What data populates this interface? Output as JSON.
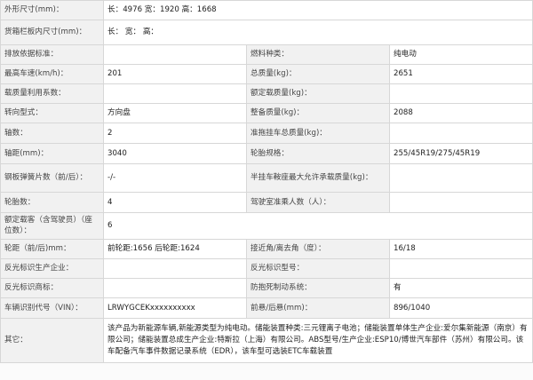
{
  "spec": {
    "outer_dims_label": "外形尺寸(mm)：",
    "outer_dims_value": "长：4976 宽：1920 高：1668",
    "cargo_dims_label": "货箱栏板内尺寸(mm)：",
    "cargo_dims_value": "长： 宽： 高：",
    "emission_label": "排放依据标准：",
    "emission_value": "",
    "fuel_type_label": "燃料种类：",
    "fuel_type_value": "纯电动",
    "max_speed_label": "最高车速(km/h)：",
    "max_speed_value": "201",
    "total_mass_label": "总质量(kg)：",
    "total_mass_value": "2651",
    "load_util_label": "载质量利用系数：",
    "load_util_value": "",
    "rated_load_label": "额定载质量(kg)：",
    "rated_load_value": "",
    "steering_label": "转向型式：",
    "steering_value": "方向盘",
    "curb_mass_label": "整备质量(kg)：",
    "curb_mass_value": "2088",
    "axles_label": "轴数：",
    "axles_value": "2",
    "trailer_mass_label": "准拖挂车总质量(kg)：",
    "trailer_mass_value": "",
    "wheelbase_label": "轴距(mm)：",
    "wheelbase_value": "3040",
    "tire_label": "轮胎规格：",
    "tire_value": "255/45R19/275/45R19",
    "springs_label": "钢板弹簧片数（前/后）：",
    "springs_value": "-/-",
    "saddle_label": "半挂车鞍座最大允许承载质量(kg)：",
    "saddle_value": "",
    "tire_count_label": "轮胎数：",
    "tire_count_value": "4",
    "cab_seats_label": "驾驶室准乘人数（人）：",
    "cab_seats_value": "",
    "passengers_label": "额定载客（含驾驶员）（座位数）：",
    "passengers_value": "6",
    "track_label": "轮距（前/后)mm：",
    "track_value": "前轮距:1656 后轮距:1624",
    "angles_label": "接近角/离去角（度）：",
    "angles_value": "16/18",
    "reflector_mfr_label": "反光标识生产企业：",
    "reflector_mfr_value": "",
    "reflector_model_label": "反光标识型号：",
    "reflector_model_value": "",
    "reflector_brand_label": "反光标识商标：",
    "reflector_brand_value": "",
    "abs_label": "防抱死制动系统：",
    "abs_value": "有",
    "vin_label": "车辆识别代号（VIN）：",
    "vin_value": "LRWYGCEKxxxxxxxxxx",
    "overhang_label": "前悬/后悬(mm)：",
    "overhang_value": "896/1040",
    "remarks_label": "其它：",
    "remarks_value": "该产品为新能源车辆,新能源类型为纯电动。储能装置种类:三元锂离子电池；储能装置单体生产企业:爱尔集新能源（南京）有限公司；储能装置总成生产企业:特斯拉（上海）有限公司。ABS型号/生产企业:ESP10/博世汽车部件（苏州）有限公司。该车配备汽车事件数据记录系统（EDR），该车型可选装ETC车载装置"
  }
}
